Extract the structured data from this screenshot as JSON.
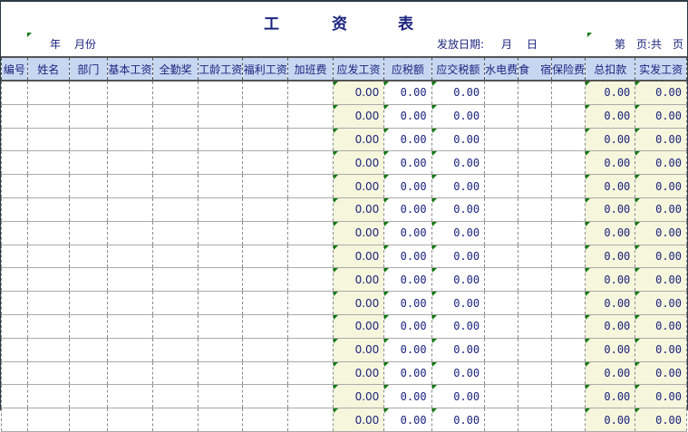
{
  "title_chars": [
    "工",
    "资",
    "表"
  ],
  "subheader": {
    "year": "年",
    "month": "月份",
    "issue_date_label": "发放日期:",
    "issue_month": "月",
    "issue_day": "日",
    "page_info": "第　页:共　页"
  },
  "columns": [
    "编号",
    "姓名",
    "部门",
    "基本工资",
    "全勤奖",
    "工龄工资",
    "福利工资",
    "加班费",
    "应发工资",
    "应税额",
    "应交税额",
    "水电费",
    "食　宿",
    "保险费",
    "总扣款",
    "实发工资"
  ],
  "row_values": {
    "gross": "0.00",
    "taxable": "0.00",
    "tax": "0.00",
    "total_deduction": "0.00",
    "net": "0.00"
  },
  "row_count": 15
}
